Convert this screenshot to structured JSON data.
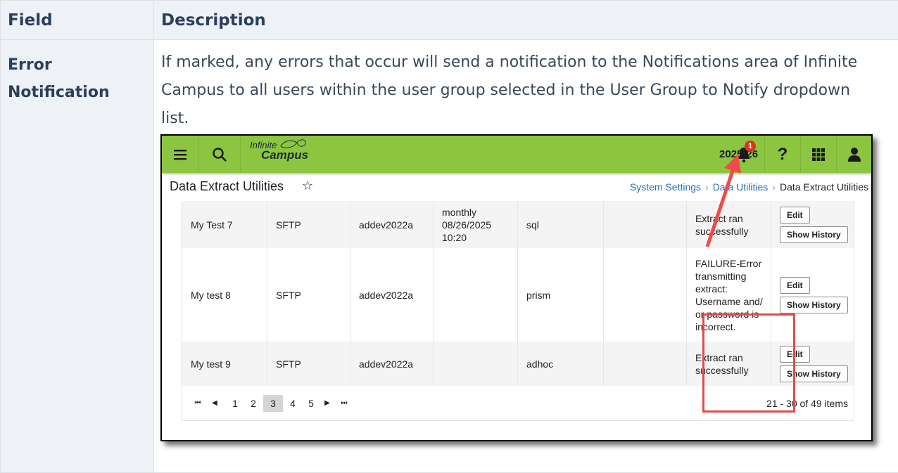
{
  "table": {
    "headers": {
      "field": "Field",
      "description": "Description"
    },
    "row": {
      "field": "Error Notification",
      "description": "If marked, any errors that occur will send a notification to the Notifications area of Infinite Campus to all users within the user group selected in the User Group to Notify dropdown list."
    }
  },
  "screenshot": {
    "topbar": {
      "logo_line1": "Infinite",
      "logo_line2": "Campus",
      "school_year": "2025-26",
      "notification_count": "1",
      "icons": [
        "menu-icon",
        "search-icon",
        "bell-icon",
        "help-icon",
        "apps-grid-icon",
        "user-icon"
      ],
      "bar_color": "#8cc640"
    },
    "page_title": "Data Extract Utilities",
    "breadcrumb": {
      "item1": "System Settings",
      "item2": "Data Utilities",
      "item3": "Data Extract Utilities",
      "link_color": "#1f6fb8"
    },
    "grid": {
      "rows": [
        {
          "name": "My Test 7",
          "protocol": "SFTP",
          "user": "addev2022a",
          "schedule_l1": "monthly",
          "schedule_l2": "08/26/2025",
          "schedule_l3": "10:20",
          "format": "sql",
          "status": "Extract ran successfully"
        },
        {
          "name": "My test 8",
          "protocol": "SFTP",
          "user": "addev2022a",
          "schedule_l1": "",
          "schedule_l2": "",
          "schedule_l3": "",
          "format": "prism",
          "status": "FAILURE-Error transmitting extract: Username and/ or password is incorrect."
        },
        {
          "name": "My test 9",
          "protocol": "SFTP",
          "user": "addev2022a",
          "schedule_l1": "",
          "schedule_l2": "",
          "schedule_l3": "",
          "format": "adhoc",
          "status": "Extract ran successfully"
        }
      ],
      "edit_label": "Edit",
      "history_label": "Show History"
    },
    "pager": {
      "first": "⏮",
      "prev": "◀",
      "pages": [
        "1",
        "2",
        "3",
        "4",
        "5"
      ],
      "current_page": "3",
      "next": "▶",
      "last": "⏭",
      "items_summary": "21 - 30 of 49 items"
    },
    "highlight_color": "#e24b4b"
  }
}
